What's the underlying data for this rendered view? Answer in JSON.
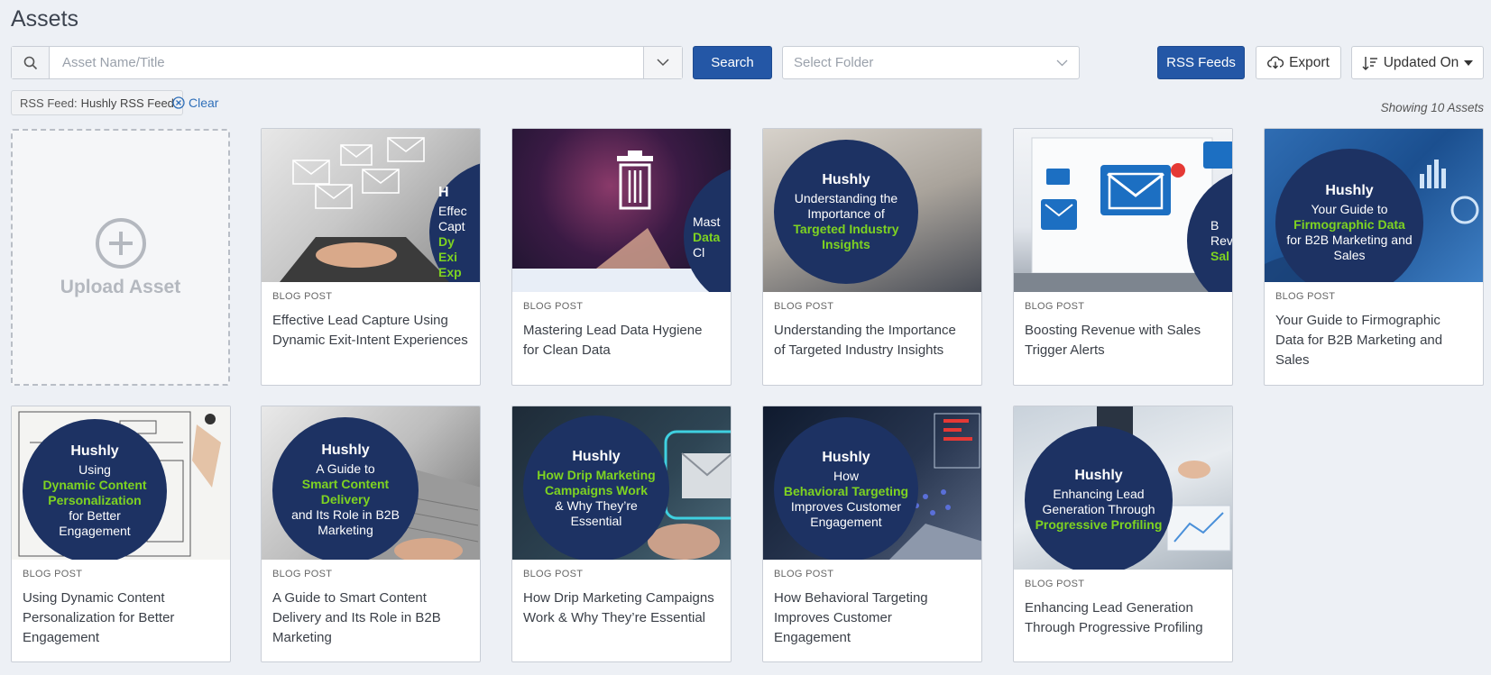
{
  "page": {
    "title": "Assets"
  },
  "search": {
    "placeholder": "Asset Name/Title",
    "button_label": "Search"
  },
  "folder": {
    "placeholder": "Select Folder"
  },
  "toolbar": {
    "rss_label": "RSS Feeds",
    "export_label": "Export",
    "sort_label": "Updated On"
  },
  "filter": {
    "prefix": "RSS Feed:",
    "value": "Hushly RSS Feed",
    "clear_label": "Clear"
  },
  "count_text": "Showing 10 Assets",
  "upload": {
    "label": "Upload Asset"
  },
  "cards": [
    {
      "type": "BLOG POST",
      "title": "Effective Lead Capture Using Dynamic Exit-Intent Experiences",
      "thumb_lines": [
        "H",
        "Effec",
        "Capt",
        "Dy",
        "Exi",
        "Exp"
      ]
    },
    {
      "type": "BLOG POST",
      "title": "Mastering Lead Data Hygiene for Clean Data",
      "thumb_lines": [
        "Mast",
        "Data",
        "Cl"
      ]
    },
    {
      "type": "BLOG POST",
      "title": "Understanding the Importance of Targeted Industry Insights",
      "thumb_brand": "Hushly",
      "thumb_text": "Understanding the Importance of",
      "thumb_accent": "Targeted Industry Insights"
    },
    {
      "type": "BLOG POST",
      "title": "Boosting Revenue with Sales Trigger Alerts",
      "thumb_lines": [
        "B",
        "Rev",
        "Sal"
      ]
    },
    {
      "type": "BLOG POST",
      "title": "Your Guide to Firmographic Data for B2B Marketing and Sales",
      "thumb_brand": "Hushly",
      "thumb_text": "Your Guide to",
      "thumb_accent": "Firmographic Data",
      "thumb_text2": "for B2B Marketing and Sales"
    },
    {
      "type": "BLOG POST",
      "title": "Using Dynamic Content Personalization for Better Engagement",
      "thumb_brand": "Hushly",
      "thumb_text": "Using",
      "thumb_accent": "Dynamic Content Personalization",
      "thumb_text2": "for Better Engagement"
    },
    {
      "type": "BLOG POST",
      "title": "A Guide to Smart Content Delivery and Its Role in B2B Marketing",
      "thumb_brand": "Hushly",
      "thumb_text": "A Guide to",
      "thumb_accent": "Smart Content Delivery",
      "thumb_text2": "and Its Role in B2B Marketing"
    },
    {
      "type": "BLOG POST",
      "title": "How Drip Marketing Campaigns Work & Why They’re Essential",
      "thumb_brand": "Hushly",
      "thumb_accent": "How Drip Marketing Campaigns Work",
      "thumb_text2": "& Why They’re Essential"
    },
    {
      "type": "BLOG POST",
      "title": "How Behavioral Targeting Improves Customer Engagement",
      "thumb_brand": "Hushly",
      "thumb_text": "How",
      "thumb_accent": "Behavioral Targeting",
      "thumb_text2": "Improves Customer Engagement"
    },
    {
      "type": "BLOG POST",
      "title": "Enhancing Lead Generation Through Progressive Profiling",
      "thumb_brand": "Hushly",
      "thumb_text": "Enhancing Lead Generation Through",
      "thumb_accent": "Progressive Profiling"
    }
  ],
  "colors": {
    "primary": "#2457a6",
    "accent_green": "#7ed321",
    "circle_navy": "#1d3263",
    "background": "#edf0f5"
  }
}
